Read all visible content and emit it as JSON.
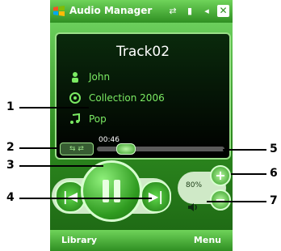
{
  "window": {
    "title": "Audio Manager"
  },
  "status": {
    "icons": [
      "sync-icon",
      "signal-icon",
      "speaker-icon"
    ],
    "close_label": "✕"
  },
  "track": {
    "title": "Track02",
    "artist": "John",
    "album": "Collection 2006",
    "genre": "Pop"
  },
  "player": {
    "time": "00:46",
    "volume": "80%",
    "progress": 0.18
  },
  "softkeys": {
    "left": "Library",
    "right": "Menu"
  },
  "callouts": {
    "n1": "1",
    "n2": "2",
    "n3": "3",
    "n4": "4",
    "n5": "5",
    "n6": "6",
    "n7": "7"
  },
  "colors": {
    "accent": "#2f8f22",
    "text_green": "#7bea63"
  }
}
